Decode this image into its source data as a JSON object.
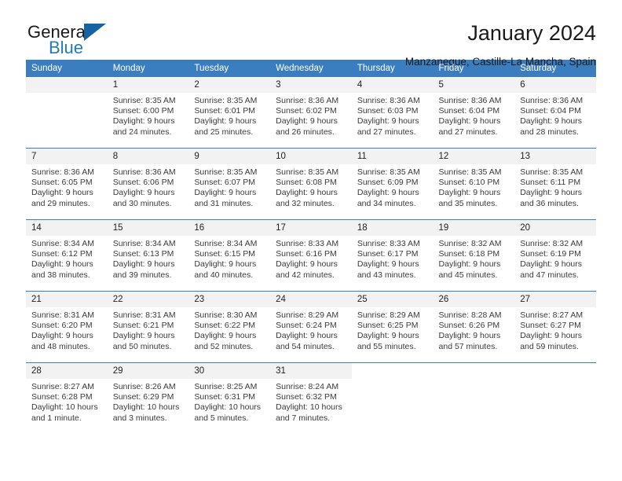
{
  "brand": {
    "word_one": "General",
    "word_two": "Blue",
    "flag_icon": "triangle-flag-icon"
  },
  "header": {
    "title": "January 2024",
    "subtitle": "Manzaneque, Castille-La Mancha, Spain"
  },
  "calendar": {
    "weekday_headers": [
      "Sunday",
      "Monday",
      "Tuesday",
      "Wednesday",
      "Thursday",
      "Friday",
      "Saturday"
    ],
    "accent_color": "#3b7ec0",
    "daynum_bg": "#f2f2f2",
    "weeks": [
      [
        {
          "day": "",
          "lines": []
        },
        {
          "day": "1",
          "lines": [
            "Sunrise: 8:35 AM",
            "Sunset: 6:00 PM",
            "Daylight: 9 hours",
            "and 24 minutes."
          ]
        },
        {
          "day": "2",
          "lines": [
            "Sunrise: 8:35 AM",
            "Sunset: 6:01 PM",
            "Daylight: 9 hours",
            "and 25 minutes."
          ]
        },
        {
          "day": "3",
          "lines": [
            "Sunrise: 8:36 AM",
            "Sunset: 6:02 PM",
            "Daylight: 9 hours",
            "and 26 minutes."
          ]
        },
        {
          "day": "4",
          "lines": [
            "Sunrise: 8:36 AM",
            "Sunset: 6:03 PM",
            "Daylight: 9 hours",
            "and 27 minutes."
          ]
        },
        {
          "day": "5",
          "lines": [
            "Sunrise: 8:36 AM",
            "Sunset: 6:04 PM",
            "Daylight: 9 hours",
            "and 27 minutes."
          ]
        },
        {
          "day": "6",
          "lines": [
            "Sunrise: 8:36 AM",
            "Sunset: 6:04 PM",
            "Daylight: 9 hours",
            "and 28 minutes."
          ]
        }
      ],
      [
        {
          "day": "7",
          "lines": [
            "Sunrise: 8:36 AM",
            "Sunset: 6:05 PM",
            "Daylight: 9 hours",
            "and 29 minutes."
          ]
        },
        {
          "day": "8",
          "lines": [
            "Sunrise: 8:36 AM",
            "Sunset: 6:06 PM",
            "Daylight: 9 hours",
            "and 30 minutes."
          ]
        },
        {
          "day": "9",
          "lines": [
            "Sunrise: 8:35 AM",
            "Sunset: 6:07 PM",
            "Daylight: 9 hours",
            "and 31 minutes."
          ]
        },
        {
          "day": "10",
          "lines": [
            "Sunrise: 8:35 AM",
            "Sunset: 6:08 PM",
            "Daylight: 9 hours",
            "and 32 minutes."
          ]
        },
        {
          "day": "11",
          "lines": [
            "Sunrise: 8:35 AM",
            "Sunset: 6:09 PM",
            "Daylight: 9 hours",
            "and 34 minutes."
          ]
        },
        {
          "day": "12",
          "lines": [
            "Sunrise: 8:35 AM",
            "Sunset: 6:10 PM",
            "Daylight: 9 hours",
            "and 35 minutes."
          ]
        },
        {
          "day": "13",
          "lines": [
            "Sunrise: 8:35 AM",
            "Sunset: 6:11 PM",
            "Daylight: 9 hours",
            "and 36 minutes."
          ]
        }
      ],
      [
        {
          "day": "14",
          "lines": [
            "Sunrise: 8:34 AM",
            "Sunset: 6:12 PM",
            "Daylight: 9 hours",
            "and 38 minutes."
          ]
        },
        {
          "day": "15",
          "lines": [
            "Sunrise: 8:34 AM",
            "Sunset: 6:13 PM",
            "Daylight: 9 hours",
            "and 39 minutes."
          ]
        },
        {
          "day": "16",
          "lines": [
            "Sunrise: 8:34 AM",
            "Sunset: 6:15 PM",
            "Daylight: 9 hours",
            "and 40 minutes."
          ]
        },
        {
          "day": "17",
          "lines": [
            "Sunrise: 8:33 AM",
            "Sunset: 6:16 PM",
            "Daylight: 9 hours",
            "and 42 minutes."
          ]
        },
        {
          "day": "18",
          "lines": [
            "Sunrise: 8:33 AM",
            "Sunset: 6:17 PM",
            "Daylight: 9 hours",
            "and 43 minutes."
          ]
        },
        {
          "day": "19",
          "lines": [
            "Sunrise: 8:32 AM",
            "Sunset: 6:18 PM",
            "Daylight: 9 hours",
            "and 45 minutes."
          ]
        },
        {
          "day": "20",
          "lines": [
            "Sunrise: 8:32 AM",
            "Sunset: 6:19 PM",
            "Daylight: 9 hours",
            "and 47 minutes."
          ]
        }
      ],
      [
        {
          "day": "21",
          "lines": [
            "Sunrise: 8:31 AM",
            "Sunset: 6:20 PM",
            "Daylight: 9 hours",
            "and 48 minutes."
          ]
        },
        {
          "day": "22",
          "lines": [
            "Sunrise: 8:31 AM",
            "Sunset: 6:21 PM",
            "Daylight: 9 hours",
            "and 50 minutes."
          ]
        },
        {
          "day": "23",
          "lines": [
            "Sunrise: 8:30 AM",
            "Sunset: 6:22 PM",
            "Daylight: 9 hours",
            "and 52 minutes."
          ]
        },
        {
          "day": "24",
          "lines": [
            "Sunrise: 8:29 AM",
            "Sunset: 6:24 PM",
            "Daylight: 9 hours",
            "and 54 minutes."
          ]
        },
        {
          "day": "25",
          "lines": [
            "Sunrise: 8:29 AM",
            "Sunset: 6:25 PM",
            "Daylight: 9 hours",
            "and 55 minutes."
          ]
        },
        {
          "day": "26",
          "lines": [
            "Sunrise: 8:28 AM",
            "Sunset: 6:26 PM",
            "Daylight: 9 hours",
            "and 57 minutes."
          ]
        },
        {
          "day": "27",
          "lines": [
            "Sunrise: 8:27 AM",
            "Sunset: 6:27 PM",
            "Daylight: 9 hours",
            "and 59 minutes."
          ]
        }
      ],
      [
        {
          "day": "28",
          "lines": [
            "Sunrise: 8:27 AM",
            "Sunset: 6:28 PM",
            "Daylight: 10 hours",
            "and 1 minute."
          ]
        },
        {
          "day": "29",
          "lines": [
            "Sunrise: 8:26 AM",
            "Sunset: 6:29 PM",
            "Daylight: 10 hours",
            "and 3 minutes."
          ]
        },
        {
          "day": "30",
          "lines": [
            "Sunrise: 8:25 AM",
            "Sunset: 6:31 PM",
            "Daylight: 10 hours",
            "and 5 minutes."
          ]
        },
        {
          "day": "31",
          "lines": [
            "Sunrise: 8:24 AM",
            "Sunset: 6:32 PM",
            "Daylight: 10 hours",
            "and 7 minutes."
          ]
        },
        {
          "day": "",
          "lines": []
        },
        {
          "day": "",
          "lines": []
        },
        {
          "day": "",
          "lines": []
        }
      ]
    ]
  }
}
